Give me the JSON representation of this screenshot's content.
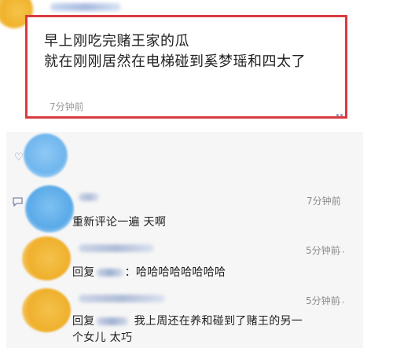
{
  "post": {
    "line1": "早上刚吃完赌王家的瓜",
    "line2": "就在刚刚居然在电梯碰到奚梦瑶和四太了",
    "time": "7分钟前",
    "more": "··"
  },
  "comments": [
    {
      "time": "7分钟前",
      "text": "重新评论一遍 天啊"
    },
    {
      "time": "5分钟前",
      "prefix": "回复",
      "text": "：哈哈哈哈哈哈哈哈"
    },
    {
      "time": "5分钟前",
      "prefix": "回复",
      "text_line1": "我上周还在养和碰到了赌王的另一",
      "text_line2": "个女儿 太巧"
    }
  ],
  "icons": {
    "like": "heart-outline-icon",
    "comment": "comment-bubble-icon"
  },
  "colors": {
    "highlight_border": "#d83b40",
    "comment_bg": "#f6f6f6",
    "meta_text": "#8c8c8c"
  }
}
